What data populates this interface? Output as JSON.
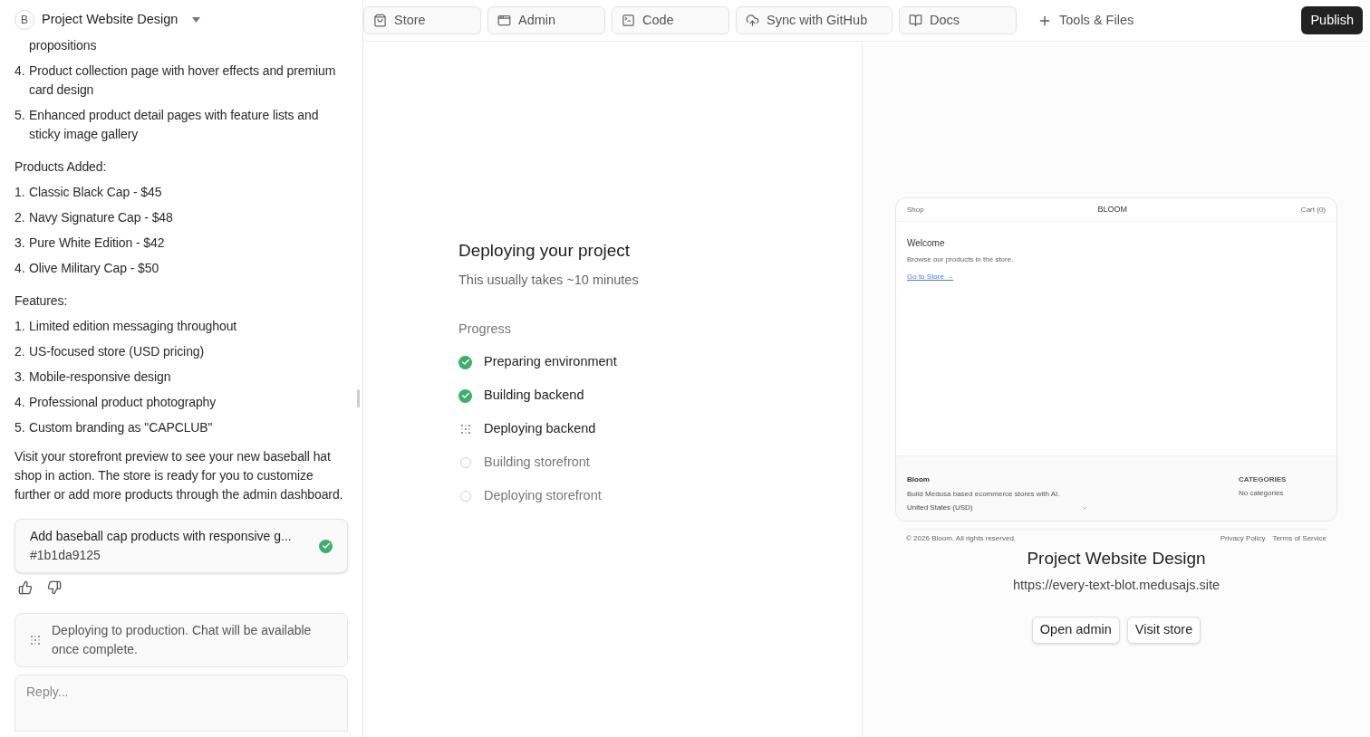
{
  "project": {
    "initial": "B",
    "name": "Project Website Design"
  },
  "chat": {
    "blocks": [
      {
        "kind": "continuation",
        "text": "propositions"
      },
      {
        "kind": "item",
        "number": "4.",
        "text": "Product collection page with hover effects and premium card design"
      },
      {
        "kind": "item",
        "number": "5.",
        "text": "Enhanced product detail pages with feature lists and sticky image gallery"
      },
      {
        "kind": "heading",
        "text": "Products Added:"
      },
      {
        "kind": "item",
        "number": "1.",
        "text": "Classic Black Cap - $45"
      },
      {
        "kind": "item",
        "number": "2.",
        "text": "Navy Signature Cap - $48"
      },
      {
        "kind": "item",
        "number": "3.",
        "text": "Pure White Edition - $42"
      },
      {
        "kind": "item",
        "number": "4.",
        "text": "Olive Military Cap - $50"
      },
      {
        "kind": "heading",
        "text": "Features:"
      },
      {
        "kind": "item",
        "number": "1.",
        "text": "Limited edition messaging throughout"
      },
      {
        "kind": "item",
        "number": "2.",
        "text": "US-focused store (USD pricing)"
      },
      {
        "kind": "item",
        "number": "3.",
        "text": "Mobile-responsive design"
      },
      {
        "kind": "item",
        "number": "4.",
        "text": "Professional product photography"
      },
      {
        "kind": "item",
        "number": "5.",
        "text": "Custom branding as \"CAPCLUB\""
      },
      {
        "kind": "paragraph",
        "text": "Visit your storefront preview to see your new baseball hat shop in action. The store is ready for you to customize further or add more products through the admin dashboard."
      }
    ],
    "commit": {
      "title": "Add baseball cap products with responsive g...",
      "hash": "#1b1da9125"
    },
    "notice": "Deploying to production. Chat will be available once complete.",
    "reply_placeholder": "Reply..."
  },
  "toolbar": {
    "tabs": [
      {
        "label": "Store"
      },
      {
        "label": "Admin"
      },
      {
        "label": "Code"
      },
      {
        "label": "Sync with GitHub"
      },
      {
        "label": "Docs"
      }
    ],
    "tools": "Tools & Files",
    "publish": "Publish"
  },
  "deploy": {
    "title": "Deploying your project",
    "subtitle": "This usually takes ~10 minutes",
    "progress_label": "Progress",
    "steps": [
      {
        "label": "Preparing environment",
        "kind": "done"
      },
      {
        "label": "Building backend",
        "kind": "done"
      },
      {
        "label": "Deploying backend",
        "kind": "active"
      },
      {
        "label": "Building storefront",
        "kind": "pending"
      },
      {
        "label": "Deploying storefront",
        "kind": "pending"
      }
    ]
  },
  "preview": {
    "nav_left": "Shop",
    "brand": "BLOOM",
    "nav_right": "Cart (0)",
    "welcome": "Welcome",
    "body": "Browse our products in the store.",
    "link": "Go to Store →",
    "footer_brand": "Bloom",
    "footer_text": "Build Medusa based ecommerce stores with AI.",
    "region": "United States (USD)",
    "categories_title": "CATEGORIES",
    "categories_empty": "No categories",
    "copyright": "© 2026 Bloom. All rights reserved.",
    "legal": [
      "Privacy Policy",
      "Terms of Service"
    ]
  },
  "site": {
    "title": "Project Website Design",
    "url": "https://every-text-blot.medusajs.site",
    "buttons": [
      "Open admin",
      "Visit store"
    ]
  }
}
